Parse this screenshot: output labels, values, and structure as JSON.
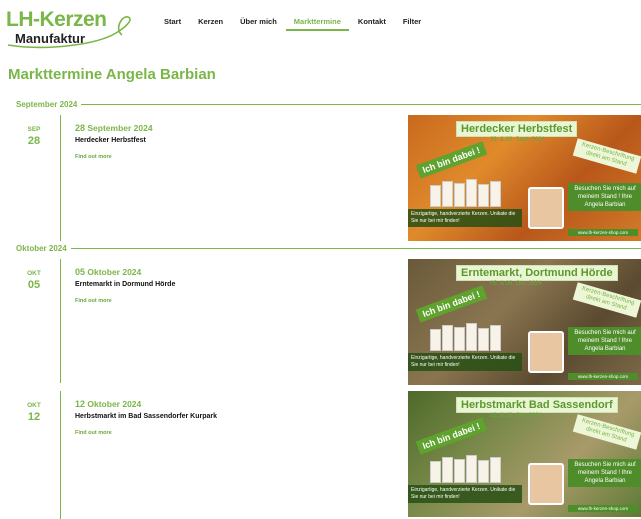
{
  "brand": {
    "line1": "LH-Kerzen",
    "line2": "Manufaktur"
  },
  "nav": {
    "items": [
      {
        "label": "Start",
        "active": false
      },
      {
        "label": "Kerzen",
        "active": false
      },
      {
        "label": "Über mich",
        "active": false
      },
      {
        "label": "Markttermine",
        "active": true
      },
      {
        "label": "Kontakt",
        "active": false
      },
      {
        "label": "Filter",
        "active": false
      }
    ]
  },
  "page": {
    "title": "Markttermine Angela Barbian"
  },
  "months": [
    "September 2024",
    "Oktober 2024"
  ],
  "events": [
    {
      "mon": "SEP",
      "day": "28",
      "date_day": "28",
      "date_rest": "September 2024",
      "title": "Herdecker Herbstfest",
      "more": "Find out more",
      "flyer": {
        "title": "Herdecker Herbstfest",
        "dates": "28. & 29. Sept. 2024",
        "badge": "Ich bin dabei !",
        "note": "Kerzen-Beschriftung direkt am Stand",
        "visit": "Besuchen Sie mich auf meinem Stand ! Ihre Angela Barbian",
        "bottom": "Einzigartige, handverzierte Kerzen. Unikate die Sie nur bei mir finden!",
        "url": "www.lh-kerzen-shop.com"
      }
    },
    {
      "mon": "OKT",
      "day": "05",
      "date_day": "05",
      "date_rest": "Oktober 2024",
      "title": "Erntemarkt in Dormund Hörde",
      "more": "Find out more",
      "flyer": {
        "title": "Erntemarkt, Dortmund Hörde",
        "dates": "05. & 06. Okt. 2024",
        "badge": "Ich bin dabei !",
        "note": "Kerzen-Beschriftung direkt am Stand",
        "visit": "Besuchen Sie mich auf meinem Stand ! Ihre Angela Barbian",
        "bottom": "Einzigartige, handverzierte Kerzen. Unikate die Sie nur bei mir finden!",
        "url": "www.lh-kerzen-shop.com"
      }
    },
    {
      "mon": "OKT",
      "day": "12",
      "date_day": "12",
      "date_rest": "Oktober 2024",
      "title": "Herbstmarkt im Bad Sassendorfer Kurpark",
      "more": "Find out more",
      "flyer": {
        "title": "Herbstmarkt Bad Sassendorf",
        "dates": "12. & 13. Okt. 2024",
        "badge": "Ich bin dabei !",
        "note": "Kerzen-Beschriftung direkt am Stand",
        "visit": "Besuchen Sie mich auf meinem Stand ! Ihre Angela Barbian",
        "bottom": "Einzigartige, handverzierte Kerzen. Unikate die Sie nur bei mir finden!",
        "url": "www.lh-kerzen-shop.com"
      }
    }
  ],
  "colors": {
    "accent": "#7ab648",
    "text": "#222222"
  }
}
